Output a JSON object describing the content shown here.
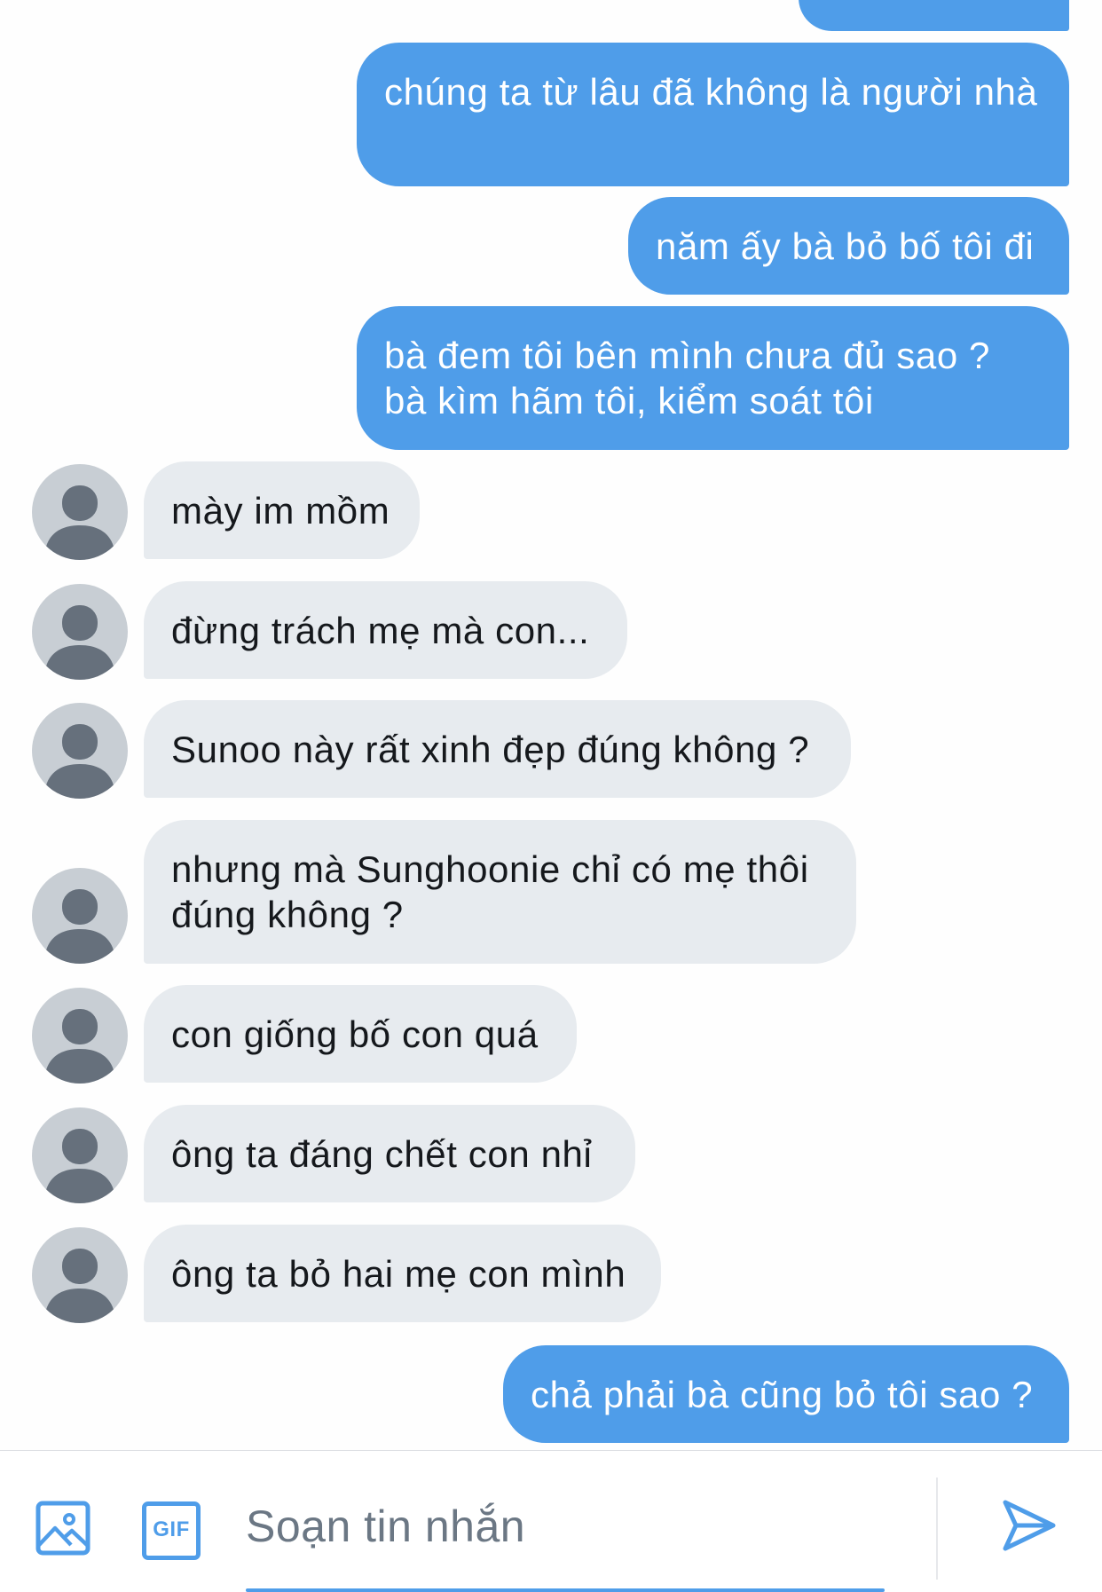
{
  "messages": [
    {
      "from": "me",
      "text": ""
    },
    {
      "from": "me",
      "text": "chúng ta từ lâu đã không là người nhà"
    },
    {
      "from": "me",
      "text": "năm ấy bà bỏ bố tôi đi"
    },
    {
      "from": "me",
      "text": "bà đem tôi bên mình chưa đủ sao ? bà kìm hãm tôi, kiểm soát tôi"
    },
    {
      "from": "them",
      "text": "mày im mồm"
    },
    {
      "from": "them",
      "text": "đừng trách mẹ mà con..."
    },
    {
      "from": "them",
      "text": "Sunoo này rất xinh đẹp đúng không ?"
    },
    {
      "from": "them",
      "text": "nhưng mà Sunghoonie chỉ có mẹ thôi đúng không ?"
    },
    {
      "from": "them",
      "text": "con giống bố con quá"
    },
    {
      "from": "them",
      "text": "ông ta đáng chết con nhỉ"
    },
    {
      "from": "them",
      "text": "ông ta bỏ hai mẹ con mình"
    },
    {
      "from": "me",
      "text": "chả phải bà cũng bỏ tôi sao ?"
    }
  ],
  "composer": {
    "placeholder": "Soạn tin nhắn",
    "gif_label": "GIF",
    "media_icon": "image-icon",
    "send_icon": "send-icon"
  },
  "colors": {
    "outgoing_bubble": "#4f9de9",
    "incoming_bubble": "#e7ebef",
    "avatar_bg": "#c8ced4",
    "avatar_fg": "#66707c",
    "accent": "#4f9de9"
  }
}
